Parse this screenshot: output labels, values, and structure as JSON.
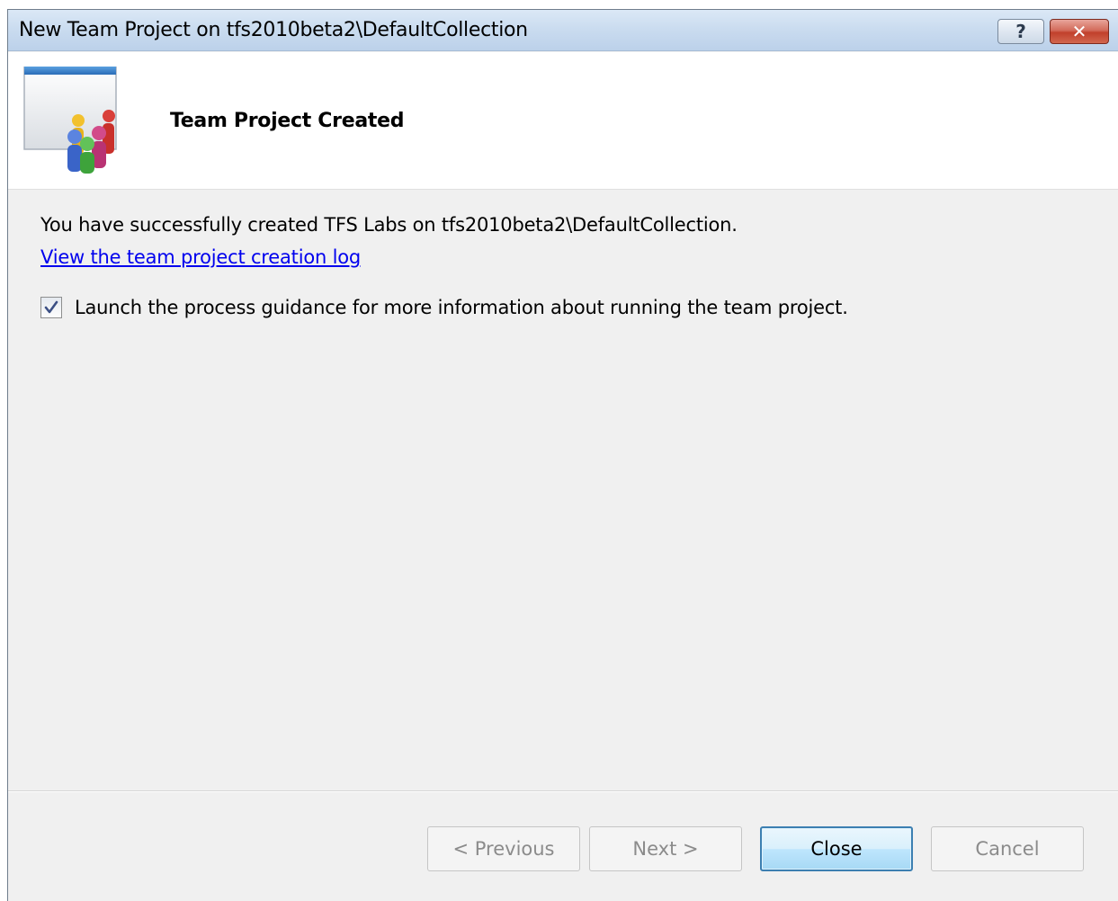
{
  "window": {
    "title": "New Team Project on tfs2010beta2\\DefaultCollection",
    "help_glyph": "?",
    "close_glyph": "✕"
  },
  "header": {
    "title": "Team Project Created",
    "icon": "team-project-wizard-icon"
  },
  "content": {
    "message": "You have successfully created TFS Labs on tfs2010beta2\\DefaultCollection.",
    "log_link": "View the team project creation log",
    "guidance_checkbox_label": "Launch the process guidance for more information about running the team project.",
    "guidance_checked": true
  },
  "buttons": {
    "previous": "< Previous",
    "next": "Next >",
    "close": "Close",
    "cancel": "Cancel"
  }
}
